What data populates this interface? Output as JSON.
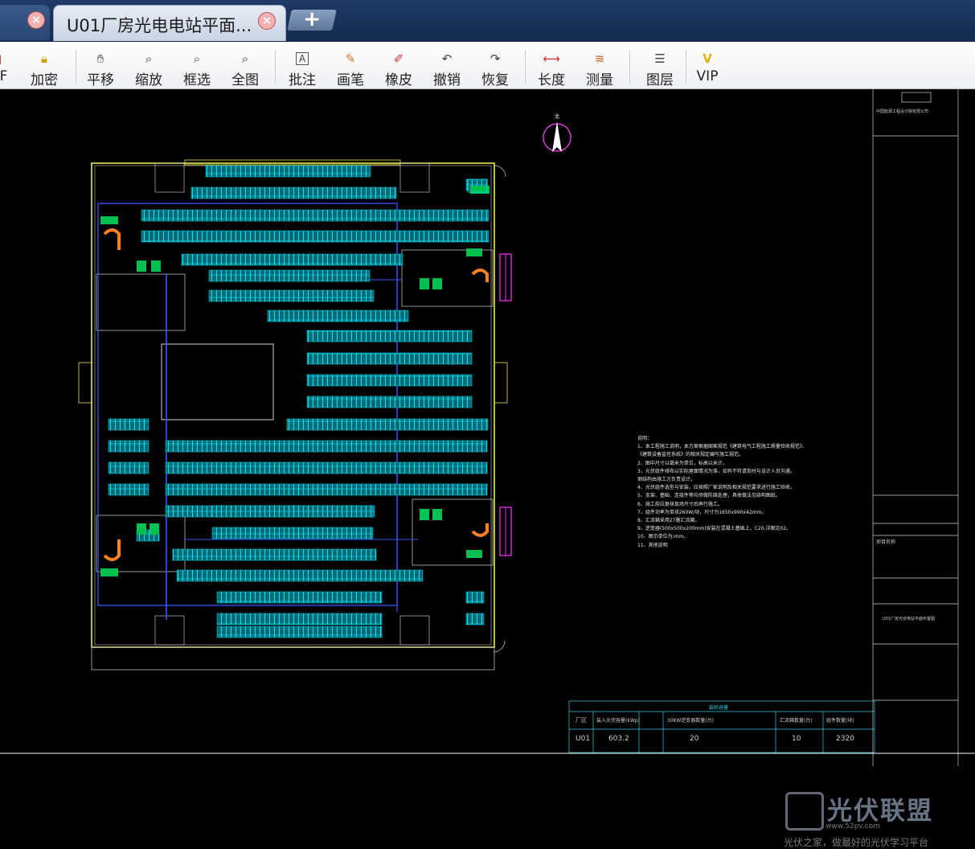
{
  "tabs": {
    "active_title": "U01厂房光电电站平面...",
    "new_tab_symbol": "+"
  },
  "toolbar": {
    "items": [
      {
        "label": "DF",
        "icon": "pdf-icon"
      },
      {
        "label": "加密",
        "icon": "lock-icon"
      },
      {
        "label": "平移",
        "icon": "pan-icon"
      },
      {
        "label": "缩放",
        "icon": "zoom-icon"
      },
      {
        "label": "框选",
        "icon": "zoom-window-icon"
      },
      {
        "label": "全图",
        "icon": "zoom-extents-icon"
      },
      {
        "label": "批注",
        "icon": "annotate-icon"
      },
      {
        "label": "画笔",
        "icon": "pen-icon"
      },
      {
        "label": "橡皮",
        "icon": "eraser-icon"
      },
      {
        "label": "撤销",
        "icon": "undo-icon"
      },
      {
        "label": "恢复",
        "icon": "redo-icon"
      },
      {
        "label": "长度",
        "icon": "length-icon"
      },
      {
        "label": "测量",
        "icon": "measure-icon"
      },
      {
        "label": "图层",
        "icon": "layers-icon"
      },
      {
        "label": "VIP",
        "icon": "vip-icon"
      }
    ]
  },
  "drawing": {
    "north_label": "北",
    "notes": [
      "说明：",
      "1、本工程施工说明，本方案根据国家规范《建筑电气工程施工质量验收规范》、",
      "  《建筑设备监控系统》的相关规定编写施工规范。",
      "2、图中尺寸以毫米为单位，标高以米计。",
      "3、光伏组件排布以实际屋面情况为准，如有不符请及时与设计人员沟通。",
      "  钢结构由施工方负责设计。",
      "4、光伏组件选型与安装，应按照厂家说明及相关规范要求进行施工验收。",
      "5、支架、基础、连接件等均须做防腐处理，具体做法见结构图纸。",
      "6、施工前应复核现场尺寸后再行施工。",
      "7、组件功率为单块260W/块，尺寸为1650x990x42mm。",
      "8、汇流箱采用27路汇流箱。",
      "9、逆变器(500x500x200mm)安装在混凝土基础上，C20,详图见02。",
      "10、图示单位为:mm。",
      "11、其他说明"
    ],
    "title_block": {
      "company": "中国能源工程设计院有限公司",
      "project_label": "项目名称",
      "drawing_title": "U01厂房光伏电站平面布置图",
      "table_header": "装机容量",
      "col_plant": "厂区",
      "col_capacity": "装入光伏容量(kWp)",
      "col_inverter": "30KW逆变器数量(台)",
      "col_combiner": "汇流箱数量(台)",
      "col_modules": "组件数量(块)",
      "row_plant": "U01",
      "row_capacity": "603.2",
      "row_inverter": "20",
      "row_combiner": "10",
      "row_modules": "2320"
    }
  },
  "watermark": {
    "title": "光伏联盟",
    "url": "www.52pv.com",
    "slogan": "光伏之家，做最好的光伏学习平台"
  },
  "colors": {
    "cad_background": "#000000",
    "building_outline": "#e8e84a",
    "panel_cyan": "#00d8e8",
    "equipment_green": "#00c050",
    "cable_blue": "#3050ff",
    "magenta": "#ff30ff"
  }
}
